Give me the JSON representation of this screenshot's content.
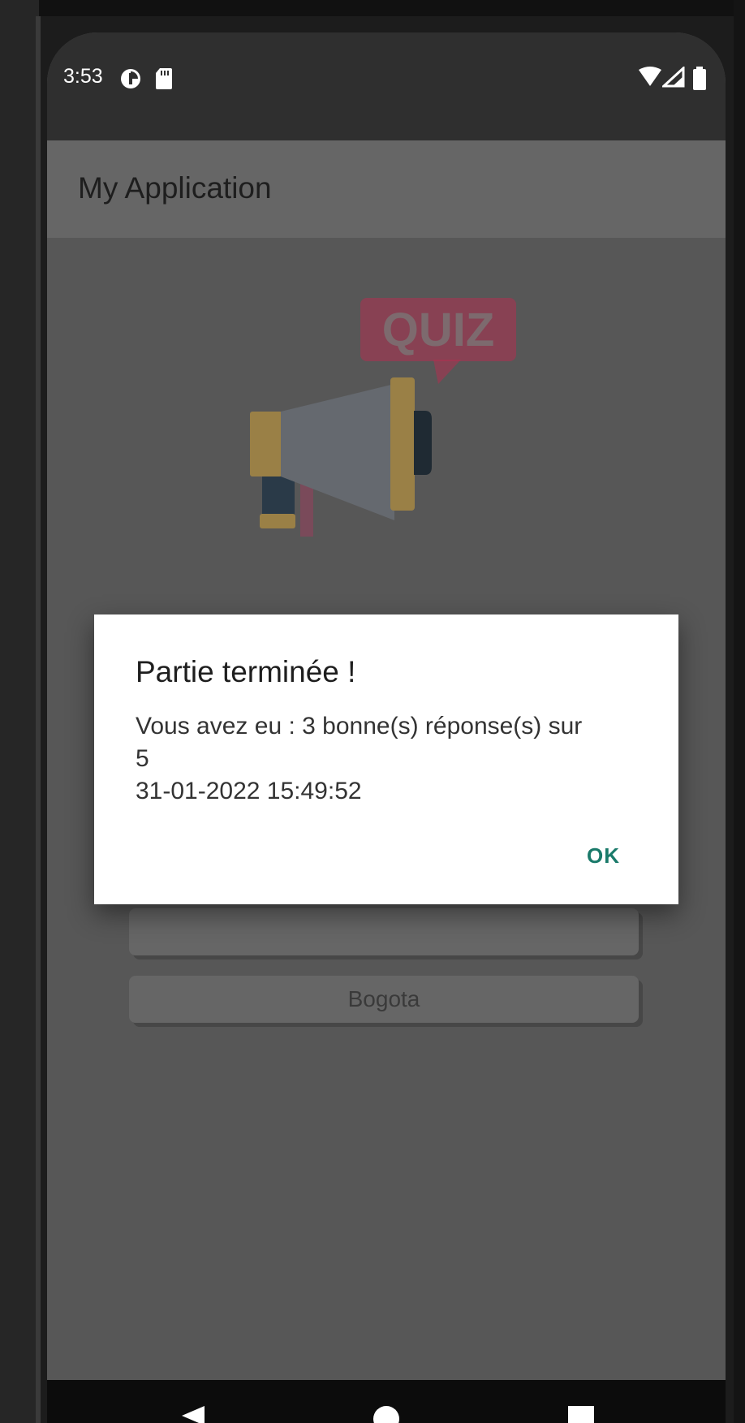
{
  "status_bar": {
    "time": "3:53",
    "icons": [
      "sync-icon",
      "sd-card-icon",
      "wifi-icon",
      "signal-icon",
      "battery-icon"
    ]
  },
  "app_bar": {
    "title": "My Application"
  },
  "illustration": {
    "badge_text": "QUIZ",
    "icon": "megaphone-icon"
  },
  "answers": [
    {
      "label": ""
    },
    {
      "label": "Bogota"
    }
  ],
  "dialog": {
    "title": "Partie terminée !",
    "message": "Vous avez eu : 3 bonne(s) réponse(s) sur\n5\n 31-01-2022 15:49:52",
    "ok_label": "OK"
  },
  "nav_bar": {
    "buttons": [
      "back-icon",
      "home-icon",
      "recents-icon"
    ]
  },
  "colors": {
    "accent": "#1a7a6a",
    "quiz_badge": "#b03050",
    "appbar": "#666666",
    "statusbar": "#2f2f2f"
  }
}
